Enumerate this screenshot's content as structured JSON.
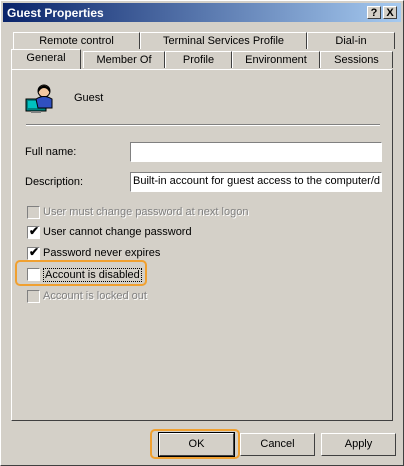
{
  "window": {
    "title": "Guest Properties",
    "help_button": "?",
    "close_button": "X"
  },
  "tabs": {
    "back_row": [
      "Remote control",
      "Terminal Services Profile",
      "Dial-in"
    ],
    "front_row": [
      "General",
      "Member Of",
      "Profile",
      "Environment",
      "Sessions"
    ],
    "selected": "General"
  },
  "user": {
    "icon": "user-icon",
    "name": "Guest"
  },
  "fields": {
    "full_name_label": "Full name:",
    "full_name_value": "",
    "description_label": "Description:",
    "description_value": "Built-in account for guest access to the computer/d"
  },
  "checkboxes": [
    {
      "label": "User must change password at next logon",
      "checked": false,
      "enabled": false
    },
    {
      "label": "User cannot change password",
      "checked": true,
      "enabled": true
    },
    {
      "label": "Password never expires",
      "checked": true,
      "enabled": true
    },
    {
      "label": "Account is disabled",
      "checked": false,
      "enabled": true
    },
    {
      "label": "Account is locked out",
      "checked": false,
      "enabled": false
    }
  ],
  "buttons": {
    "ok": "OK",
    "cancel": "Cancel",
    "apply": "Apply"
  },
  "highlight_color": "#f0a030"
}
